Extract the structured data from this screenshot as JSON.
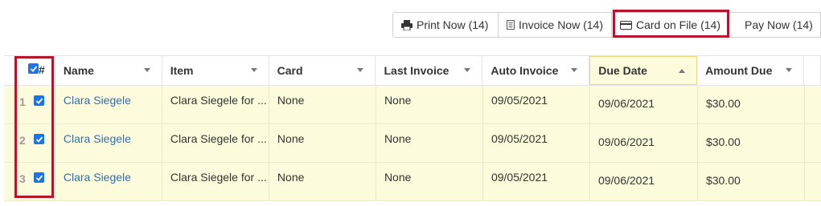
{
  "toolbar": {
    "print": "Print Now (14)",
    "invoice": "Invoice Now (14)",
    "card": "Card on File (14)",
    "pay": "Pay Now (14)"
  },
  "table": {
    "select_header": "#",
    "columns": [
      "Name",
      "Item",
      "Card",
      "Last Invoice",
      "Auto Invoice",
      "Due Date",
      "Amount Due"
    ],
    "sorted_column": "Due Date",
    "rows": [
      {
        "num": "1",
        "name": "Clara Siegele",
        "item": "Clara Siegele for ...",
        "card": "None",
        "last_invoice": "None",
        "auto_invoice": "09/05/2021",
        "due_date": "09/06/2021",
        "amount_due": "$30.00"
      },
      {
        "num": "2",
        "name": "Clara Siegele",
        "item": "Clara Siegele for ...",
        "card": "None",
        "last_invoice": "None",
        "auto_invoice": "09/05/2021",
        "due_date": "09/06/2021",
        "amount_due": "$30.00"
      },
      {
        "num": "3",
        "name": "Clara Siegele",
        "item": "Clara Siegele for ...",
        "card": "None",
        "last_invoice": "None",
        "auto_invoice": "09/05/2021",
        "due_date": "09/06/2021",
        "amount_due": "$30.00"
      }
    ]
  },
  "colors": {
    "highlight": "#b5142a",
    "row_bg": "#fcfcdc",
    "link": "#2f6db5",
    "checkbox": "#1a73e8"
  }
}
